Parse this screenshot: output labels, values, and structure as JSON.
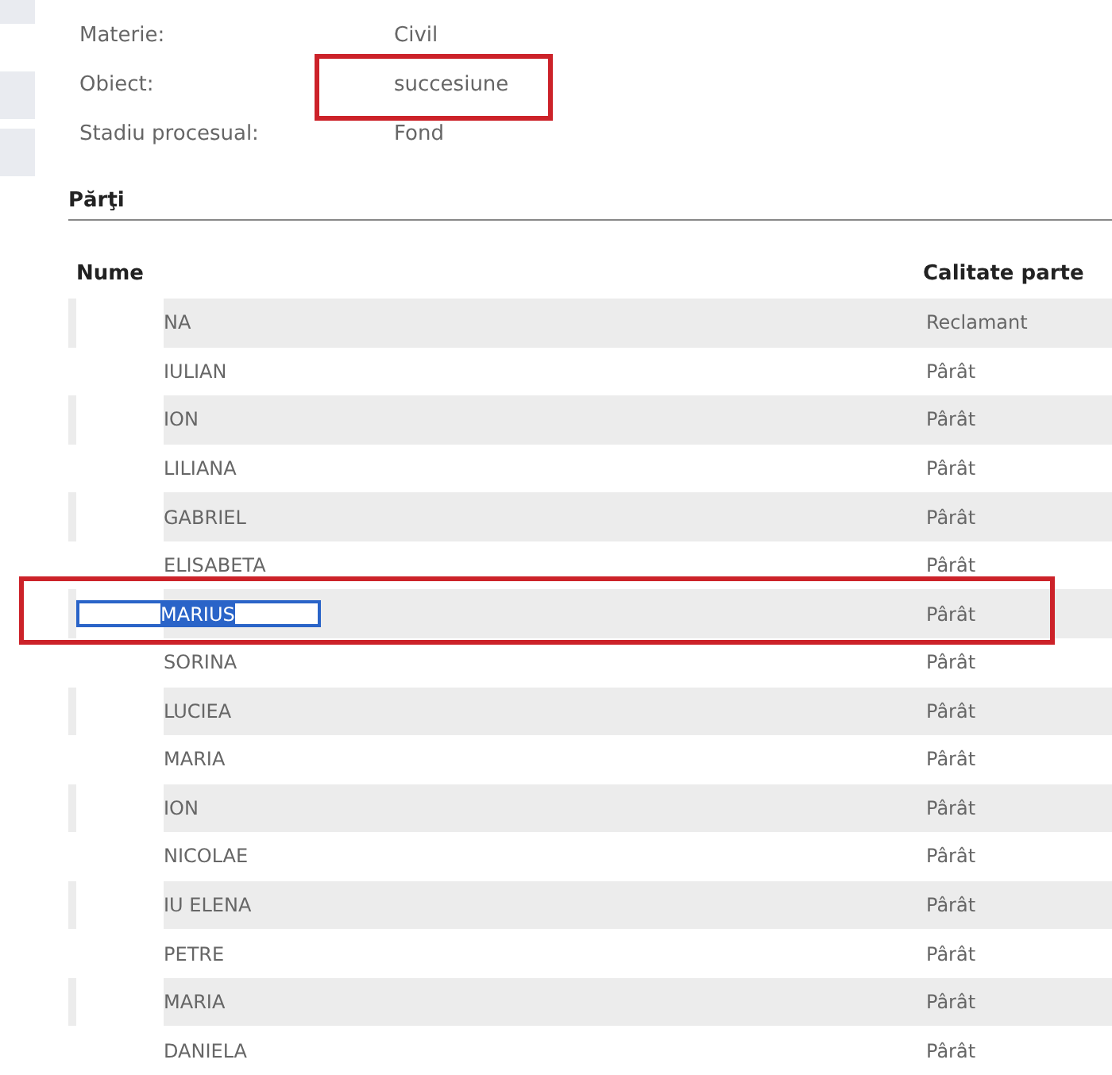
{
  "details": [
    {
      "label": "Materie:",
      "value": "Civil",
      "annotated": false
    },
    {
      "label": "Obiect:",
      "value": "succesiune",
      "annotated": true
    },
    {
      "label": "Stadiu procesual:",
      "value": "Fond",
      "annotated": false
    }
  ],
  "parties": {
    "title": "Părţi",
    "columns": [
      "Nume",
      "Calitate parte"
    ],
    "rows": [
      {
        "name": "NA",
        "role": "Reclamant",
        "selected": false,
        "annotated": false
      },
      {
        "name": "IULIAN",
        "role": "Pârât",
        "selected": false,
        "annotated": false
      },
      {
        "name": "ION",
        "role": "Pârât",
        "selected": false,
        "annotated": false
      },
      {
        "name": "LILIANA",
        "role": "Pârât",
        "selected": false,
        "annotated": false
      },
      {
        "name": "GABRIEL",
        "role": "Pârât",
        "selected": false,
        "annotated": false
      },
      {
        "name": "ELISABETA",
        "role": "Pârât",
        "selected": false,
        "annotated": false
      },
      {
        "name": "MARIUS",
        "role": "Pârât",
        "selected": true,
        "annotated": true
      },
      {
        "name": "SORINA",
        "role": "Pârât",
        "selected": false,
        "annotated": false
      },
      {
        "name": "LUCIEA",
        "role": "Pârât",
        "selected": false,
        "annotated": false
      },
      {
        "name": "MARIA",
        "role": "Pârât",
        "selected": false,
        "annotated": false
      },
      {
        "name": "ION",
        "role": "Pârât",
        "selected": false,
        "annotated": false
      },
      {
        "name": "NICOLAE",
        "role": "Pârât",
        "selected": false,
        "annotated": false
      },
      {
        "name": "IU ELENA",
        "role": "Pârât",
        "selected": false,
        "annotated": false
      },
      {
        "name": "PETRE",
        "role": "Pârât",
        "selected": false,
        "annotated": false
      },
      {
        "name": "MARIA",
        "role": "Pârât",
        "selected": false,
        "annotated": false
      },
      {
        "name": "DANIELA",
        "role": "Pârât",
        "selected": false,
        "annotated": false
      }
    ]
  }
}
